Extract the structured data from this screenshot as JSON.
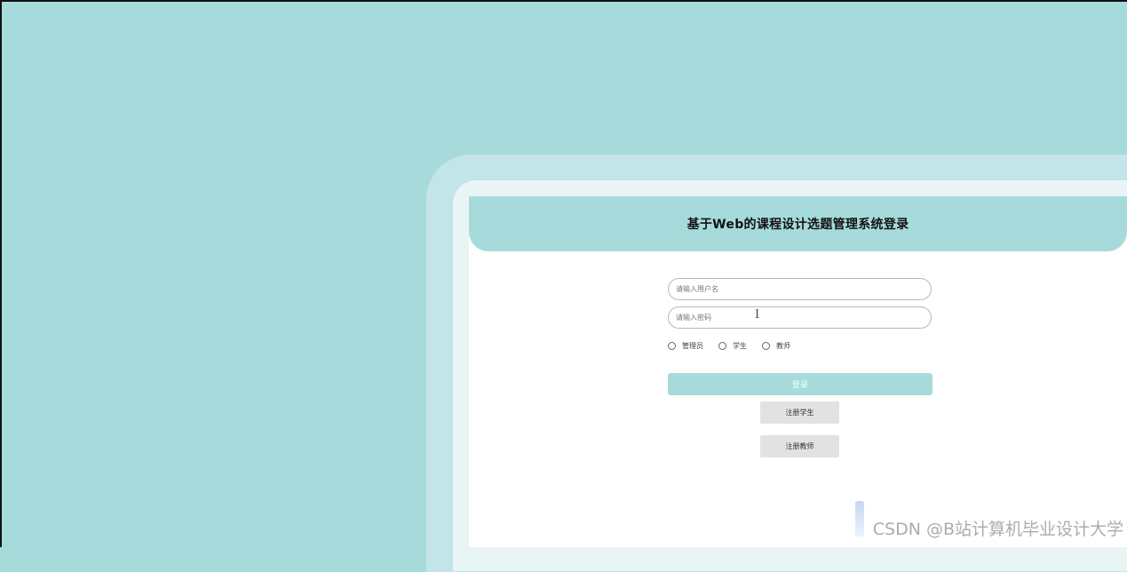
{
  "header": {
    "title": "基于Web的课程设计选题管理系统登录"
  },
  "form": {
    "username_placeholder": "请输入用户名",
    "username_value": "",
    "password_placeholder": "请输入密码",
    "password_value": "",
    "roles": [
      {
        "label": "管理员"
      },
      {
        "label": "学生"
      },
      {
        "label": "教师"
      }
    ],
    "login_label": "登录",
    "register_student_label": "注册学生",
    "register_teacher_label": "注册教师"
  },
  "watermark": {
    "text": "CSDN @B站计算机毕业设计大学"
  },
  "colors": {
    "accent": "#a7dbdb",
    "frame": "#c3e4e8",
    "secondary_button": "#e2e2e2"
  },
  "icons": {
    "cursor": "text-cursor-icon",
    "radio": "radio-button-icon"
  }
}
